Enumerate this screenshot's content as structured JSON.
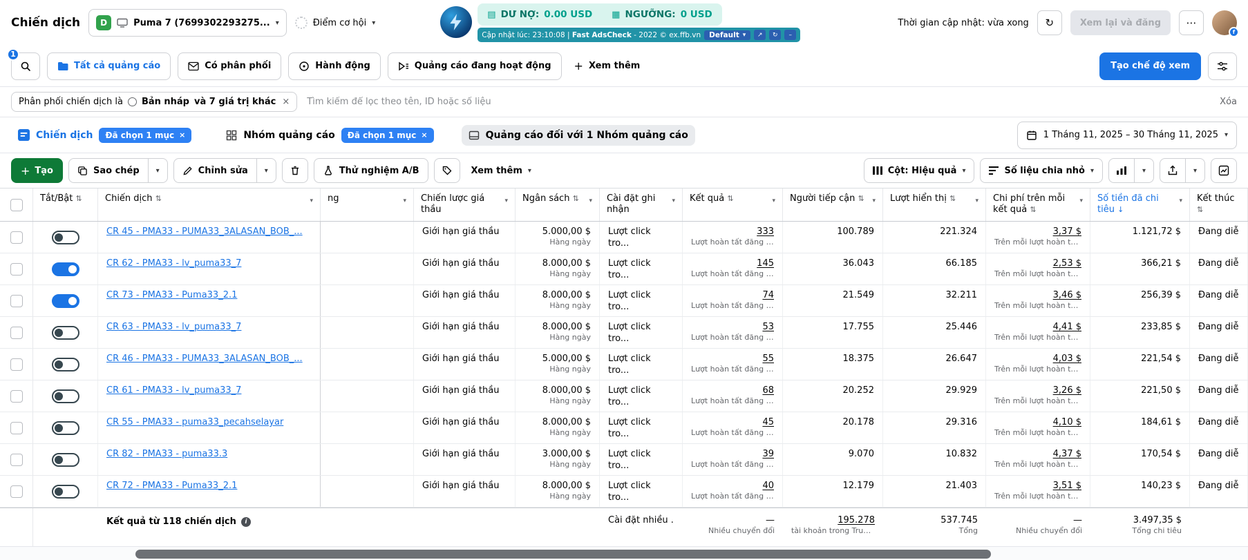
{
  "icons": {
    "caret": "▾",
    "sort": "⇅",
    "sort_desc": "↓",
    "close": "×",
    "plus": "+",
    "dots": "⋯",
    "info": "i",
    "refresh": "↻",
    "popout": "↗",
    "minus": "–",
    "debt": "▤",
    "threshold": "▦",
    "fb": "f"
  },
  "header": {
    "page_title": "Chiến dịch",
    "account_initial": "D",
    "account_name": "Puma 7 (7699302293275...",
    "opportunity_label": "Điểm cơ hội",
    "balance": {
      "debt_label": "DƯ NỢ:",
      "debt_value": "0.00 USD",
      "threshold_label": "NGƯỠNG:",
      "threshold_value": "0 USD"
    },
    "adscheck": {
      "updated_prefix": "Cập nhật lúc: 23:10:08 |",
      "brand": "Fast AdsCheck",
      "suffix": "- 2022 © ex.ffb.vn",
      "profile": "Default"
    },
    "update_time": "Thời gian cập nhật: vừa xong",
    "review_button": "Xem lại và đăng"
  },
  "view_tabs": {
    "search_badge": "1",
    "tabs": [
      {
        "label": "Tất cả quảng cáo"
      },
      {
        "label": "Có phân phối"
      },
      {
        "label": "Hành động"
      },
      {
        "label": "Quảng cáo đang hoạt động"
      }
    ],
    "see_more": "Xem thêm",
    "create_view": "Tạo chế độ xem"
  },
  "filter_bar": {
    "chip_prefix": "Phân phối chiến dịch là",
    "chip_value": "Bản nháp",
    "chip_suffix": "và 7 giá trị khác",
    "search_placeholder": "Tìm kiếm để lọc theo tên, ID hoặc số liệu",
    "clear": "Xóa"
  },
  "level_tabs": {
    "campaign": "Chiến dịch",
    "campaign_chip": "Đã chọn 1 mục",
    "adset": "Nhóm quảng cáo",
    "adset_chip": "Đã chọn 1 mục",
    "ads": "Quảng cáo đối với 1 Nhóm quảng cáo",
    "date_range": "1 Tháng 11, 2025 – 30 Tháng 11, 2025"
  },
  "toolbar": {
    "create": "Tạo",
    "duplicate": "Sao chép",
    "edit": "Chỉnh sửa",
    "ab_test": "Thử nghiệm A/B",
    "see_more": "Xem thêm",
    "columns": "Cột: Hiệu quả",
    "breakdown": "Số liệu chia nhỏ"
  },
  "table": {
    "headers": {
      "toggle": "Tắt/Bật",
      "campaign": "Chiến dịch",
      "partial": "ng",
      "bid_strategy": "Chiến lược giá thầu",
      "budget": "Ngân sách",
      "attribution": "Cài đặt ghi nhận",
      "results": "Kết quả",
      "reach": "Người tiếp cận",
      "impressions": "Lượt hiển thị",
      "cost_per_result": "Chi phí trên mỗi kết quả",
      "amount_spent": "Số tiền đã chi tiêu",
      "end": "Kết thúc"
    },
    "rows": [
      {
        "on": false,
        "name": "CR 45 - PMA33 - PUMA33_3ALASAN_BOB_...",
        "bid": "Giới hạn giá thầu",
        "budget": "5.000,00 $",
        "budget_sub": "Hàng ngày",
        "attr": "Lượt click tro...",
        "result": "333",
        "result_sub": "Lượt hoàn tất đăng k...",
        "reach": "100.789",
        "impr": "221.324",
        "cpr": "3,37 $",
        "cpr_sub": "Trên mỗi lượt hoàn tấ...",
        "spent": "1.121,72 $",
        "end": "Đang diễ"
      },
      {
        "on": true,
        "name": "CR 62 - PMA33 - lv_puma33_7",
        "bid": "Giới hạn giá thầu",
        "budget": "8.000,00 $",
        "budget_sub": "Hàng ngày",
        "attr": "Lượt click tro...",
        "result": "145",
        "result_sub": "Lượt hoàn tất đăng k...",
        "reach": "36.043",
        "impr": "66.185",
        "cpr": "2,53 $",
        "cpr_sub": "Trên mỗi lượt hoàn tấ...",
        "spent": "366,21 $",
        "end": "Đang diễ"
      },
      {
        "on": true,
        "name": "CR 73 - PMA33 - Puma33_2.1",
        "bid": "Giới hạn giá thầu",
        "budget": "8.000,00 $",
        "budget_sub": "Hàng ngày",
        "attr": "Lượt click tro...",
        "result": "74",
        "result_sub": "Lượt hoàn tất đăng k...",
        "reach": "21.549",
        "impr": "32.211",
        "cpr": "3,46 $",
        "cpr_sub": "Trên mỗi lượt hoàn tấ...",
        "spent": "256,39 $",
        "end": "Đang diễ"
      },
      {
        "on": false,
        "name": "CR 63 - PMA33 - lv_puma33_7",
        "bid": "Giới hạn giá thầu",
        "budget": "8.000,00 $",
        "budget_sub": "Hàng ngày",
        "attr": "Lượt click tro...",
        "result": "53",
        "result_sub": "Lượt hoàn tất đăng k...",
        "reach": "17.755",
        "impr": "25.446",
        "cpr": "4,41 $",
        "cpr_sub": "Trên mỗi lượt hoàn tấ...",
        "spent": "233,85 $",
        "end": "Đang diễ"
      },
      {
        "on": false,
        "name": "CR 46 - PMA33 - PUMA33_3ALASAN_BOB_...",
        "bid": "Giới hạn giá thầu",
        "budget": "5.000,00 $",
        "budget_sub": "Hàng ngày",
        "attr": "Lượt click tro...",
        "result": "55",
        "result_sub": "Lượt hoàn tất đăng k...",
        "reach": "18.375",
        "impr": "26.647",
        "cpr": "4,03 $",
        "cpr_sub": "Trên mỗi lượt hoàn tấ...",
        "spent": "221,54 $",
        "end": "Đang diễ"
      },
      {
        "on": false,
        "name": "CR 61 - PMA33 - lv_puma33_7",
        "bid": "Giới hạn giá thầu",
        "budget": "8.000,00 $",
        "budget_sub": "Hàng ngày",
        "attr": "Lượt click tro...",
        "result": "68",
        "result_sub": "Lượt hoàn tất đăng k...",
        "reach": "20.252",
        "impr": "29.929",
        "cpr": "3,26 $",
        "cpr_sub": "Trên mỗi lượt hoàn tấ...",
        "spent": "221,50 $",
        "end": "Đang diễ"
      },
      {
        "on": false,
        "name": "CR 55 - PMA33 - puma33_pecahselayar",
        "bid": "Giới hạn giá thầu",
        "budget": "8.000,00 $",
        "budget_sub": "Hàng ngày",
        "attr": "Lượt click tro...",
        "result": "45",
        "result_sub": "Lượt hoàn tất đăng k...",
        "reach": "20.178",
        "impr": "29.316",
        "cpr": "4,10 $",
        "cpr_sub": "Trên mỗi lượt hoàn tấ...",
        "spent": "184,61 $",
        "end": "Đang diễ"
      },
      {
        "on": false,
        "name": "CR 82 - PMA33 - puma33.3",
        "bid": "Giới hạn giá thầu",
        "budget": "3.000,00 $",
        "budget_sub": "Hàng ngày",
        "attr": "Lượt click tro...",
        "result": "39",
        "result_sub": "Lượt hoàn tất đăng k...",
        "reach": "9.070",
        "impr": "10.832",
        "cpr": "4,37 $",
        "cpr_sub": "Trên mỗi lượt hoàn tấ...",
        "spent": "170,54 $",
        "end": "Đang diễ"
      },
      {
        "on": false,
        "name": "CR 72 - PMA33 - Puma33_2.1",
        "bid": "Giới hạn giá thầu",
        "budget": "8.000,00 $",
        "budget_sub": "Hàng ngày",
        "attr": "Lượt click tro...",
        "result": "40",
        "result_sub": "Lượt hoàn tất đăng k...",
        "reach": "12.179",
        "impr": "21.403",
        "cpr": "3,51 $",
        "cpr_sub": "Trên mỗi lượt hoàn tấ...",
        "spent": "140,23 $",
        "end": "Đang diễ"
      }
    ],
    "footer": {
      "summary": "Kết quả từ 118 chiến dịch",
      "attribution": "Cài đặt nhiều ...",
      "results": "—",
      "results_sub": "Nhiều chuyển đổi",
      "reach": "195.278",
      "reach_sub": "tài khoản trong Trung ...",
      "impressions": "537.745",
      "impressions_sub": "Tổng",
      "cpr": "—",
      "cpr_sub": "Nhiều chuyển đổi",
      "spent": "3.497,35 $",
      "spent_sub": "Tổng chi tiêu"
    }
  }
}
